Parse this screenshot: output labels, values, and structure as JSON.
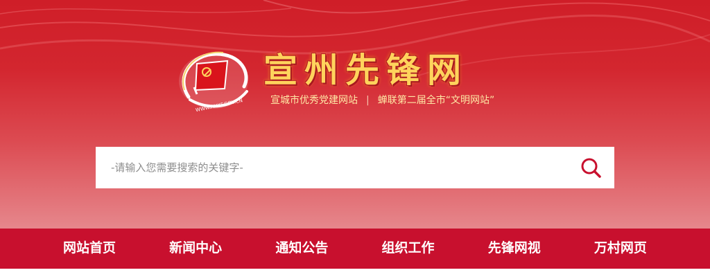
{
  "header": {
    "site_title": "宣州先锋网",
    "emblem_text": "WWW.AHXF.GOV.CN",
    "tagline_left": "宣城市优秀党建网站",
    "tagline_separator": "|",
    "tagline_right": "蝉联第二届全市“文明网站”"
  },
  "search": {
    "placeholder": "-请输入您需要搜索的关键字-",
    "value": "",
    "button_icon": "search-icon"
  },
  "nav": {
    "items": [
      {
        "label": "网站首页"
      },
      {
        "label": "新闻中心"
      },
      {
        "label": "通知公告"
      },
      {
        "label": "组织工作"
      },
      {
        "label": "先锋网视"
      },
      {
        "label": "万村网页"
      }
    ]
  },
  "colors": {
    "banner_top": "#cf1e28",
    "banner_bottom": "#e6878c",
    "nav_background": "#c8102e",
    "title_gold": "#ffd35c",
    "search_icon": "#c8102e"
  }
}
